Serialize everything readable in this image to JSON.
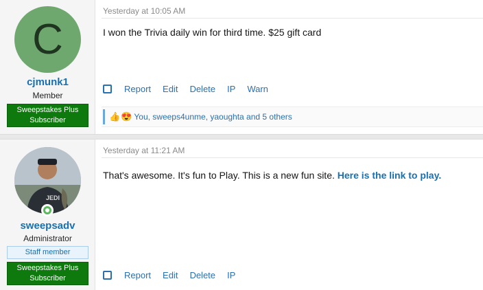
{
  "posts": [
    {
      "avatar_letter": "C",
      "username": "cjmunk1",
      "user_title": "Member",
      "banner": "Sweepstakes Plus Subscriber",
      "date": "Yesterday at 10:05 AM",
      "content": "I won the Trivia daily win for third time. $25 gift card",
      "actions": [
        "Report",
        "Edit",
        "Delete",
        "IP",
        "Warn"
      ],
      "reactions_text": "You, sweeps4unme, yaoughta and 5 others",
      "reaction_icons": [
        "thumbs-up-icon",
        "heart-eyes-icon"
      ]
    },
    {
      "username": "sweepsadv",
      "user_title": "Administrator",
      "staff_banner": "Staff member",
      "banner": "Sweepstakes Plus Subscriber",
      "date": "Yesterday at 11:21 AM",
      "content_text": "That's awesome. It's fun to Play. This is a new fun site.",
      "content_link": "Here is the link to play.",
      "actions": [
        "Report",
        "Edit",
        "Delete",
        "IP"
      ]
    }
  ],
  "colors": {
    "link": "#1a6fb0",
    "banner_green": "#0e7a0e",
    "avatar_green": "#6fa86f",
    "online": "#5cb85c"
  }
}
